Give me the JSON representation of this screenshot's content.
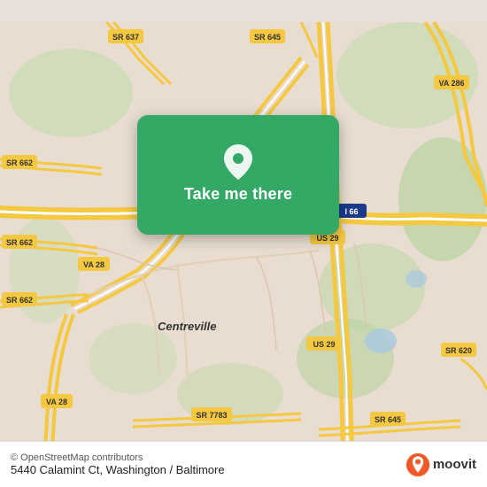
{
  "map": {
    "background_color": "#e8ddd0",
    "center_lat": 38.83,
    "center_lng": -77.43
  },
  "card": {
    "take_me_label": "Take me there",
    "background_color": "#34a865"
  },
  "bottom_bar": {
    "copyright": "© OpenStreetMap contributors",
    "address": "5440 Calamint Ct, Washington / Baltimore",
    "brand_name": "moovit"
  },
  "roads": {
    "sr637": "SR 637",
    "sr645_top": "SR 645",
    "sr662_top": "SR 662",
    "va286": "VA 286",
    "sr662_mid": "SR 662",
    "sr662_bot": "SR 662",
    "va28_top": "VA 28",
    "i66": "I 66",
    "va28_bot": "VA 28",
    "us29_top": "US 29",
    "us29_bot": "US 29",
    "sr7783": "SR 7783",
    "sr645_bot": "SR 645",
    "sr620": "SR 620",
    "centreville": "Centreville"
  }
}
